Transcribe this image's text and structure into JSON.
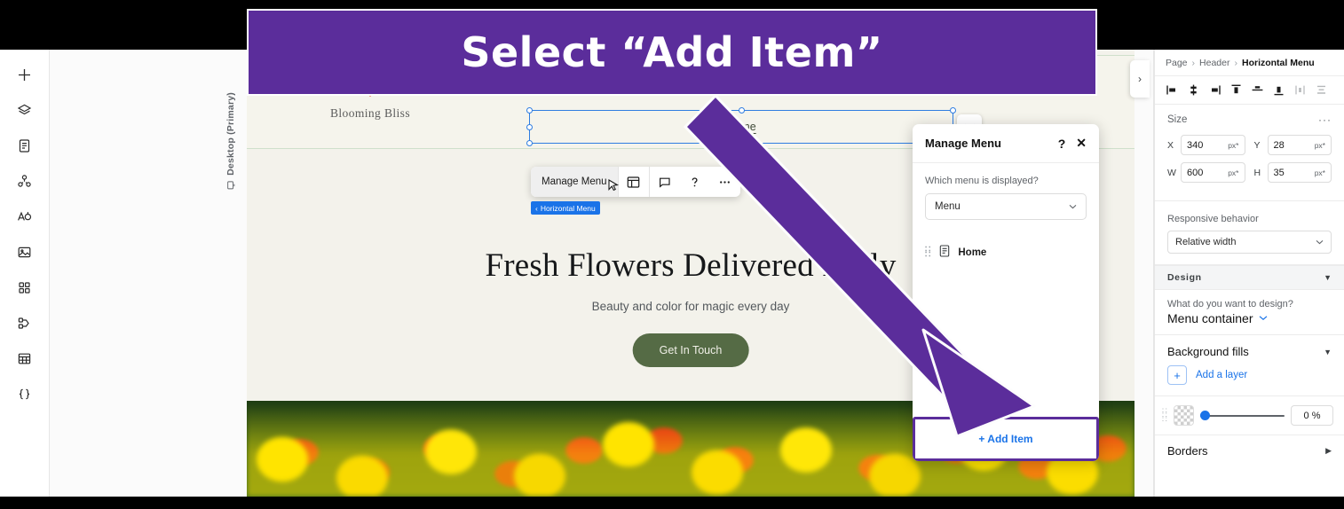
{
  "banner": {
    "text": "Select “Add Item”",
    "bg": "#5B2D9B",
    "text_color": "#FFFFFF"
  },
  "rail": {
    "items": [
      {
        "name": "add-icon",
        "label": "Add"
      },
      {
        "name": "layers-icon",
        "label": "Layers"
      },
      {
        "name": "pages-icon",
        "label": "Pages"
      },
      {
        "name": "cms-icon",
        "label": "CMS"
      },
      {
        "name": "text-styles-icon",
        "label": "Text"
      },
      {
        "name": "media-icon",
        "label": "Media"
      },
      {
        "name": "apps-icon",
        "label": "Apps"
      },
      {
        "name": "interactions-icon",
        "label": "Interactions"
      },
      {
        "name": "table-icon",
        "label": "Table"
      },
      {
        "name": "code-icon",
        "label": "Dev Mode"
      }
    ]
  },
  "canvas": {
    "viewport_label": "Desktop (Primary)",
    "logo_name": "Blooming Bliss",
    "menu_item": "Home",
    "element_toolbar": {
      "manage_label": "Manage Menu",
      "icons": [
        "layout-icon",
        "comment-icon",
        "help-icon",
        "more-icon"
      ]
    },
    "element_badge": "Horizontal Menu",
    "hero_title": "Fresh Flowers Delivered Daily",
    "hero_subtitle": "Beauty and color for magic every day",
    "cta_label": "Get In Touch"
  },
  "manage_menu_panel": {
    "title": "Manage Menu",
    "help_glyph": "?",
    "close_glyph": "✕",
    "question": "Which menu is displayed?",
    "selected_menu": "Menu",
    "items": [
      {
        "label": "Home",
        "icon": "page-icon"
      }
    ],
    "add_item_label": "+ Add Item",
    "add_item_highlight_color": "#5B2D9B"
  },
  "inspector": {
    "breadcrumb": {
      "parts": [
        "Page",
        "Header"
      ],
      "current": "Horizontal Menu",
      "separator": "›"
    },
    "align_icons": [
      "align-left-icon",
      "align-center-horizontal-icon",
      "align-right-icon",
      "align-top-icon",
      "align-middle-vertical-icon",
      "align-bottom-icon",
      "distribute-horizontal-icon",
      "distribute-vertical-icon"
    ],
    "size": {
      "title": "Size",
      "more_glyph": "···",
      "fields": [
        {
          "key": "X",
          "value": "340",
          "unit": "px*"
        },
        {
          "key": "Y",
          "value": "28",
          "unit": "px*"
        },
        {
          "key": "W",
          "value": "600",
          "unit": "px*"
        },
        {
          "key": "H",
          "value": "35",
          "unit": "px*"
        }
      ]
    },
    "responsive": {
      "label": "Responsive behavior",
      "value": "Relative width"
    },
    "design": {
      "section_title": "Design",
      "question": "What do you want to design?",
      "target": "Menu container",
      "background_fills_title": "Background fills",
      "add_layer_label": "Add a layer",
      "add_layer_plus": "+",
      "opacity_value": "0 %",
      "borders_title": "Borders"
    }
  },
  "collapse_chevron": "›"
}
